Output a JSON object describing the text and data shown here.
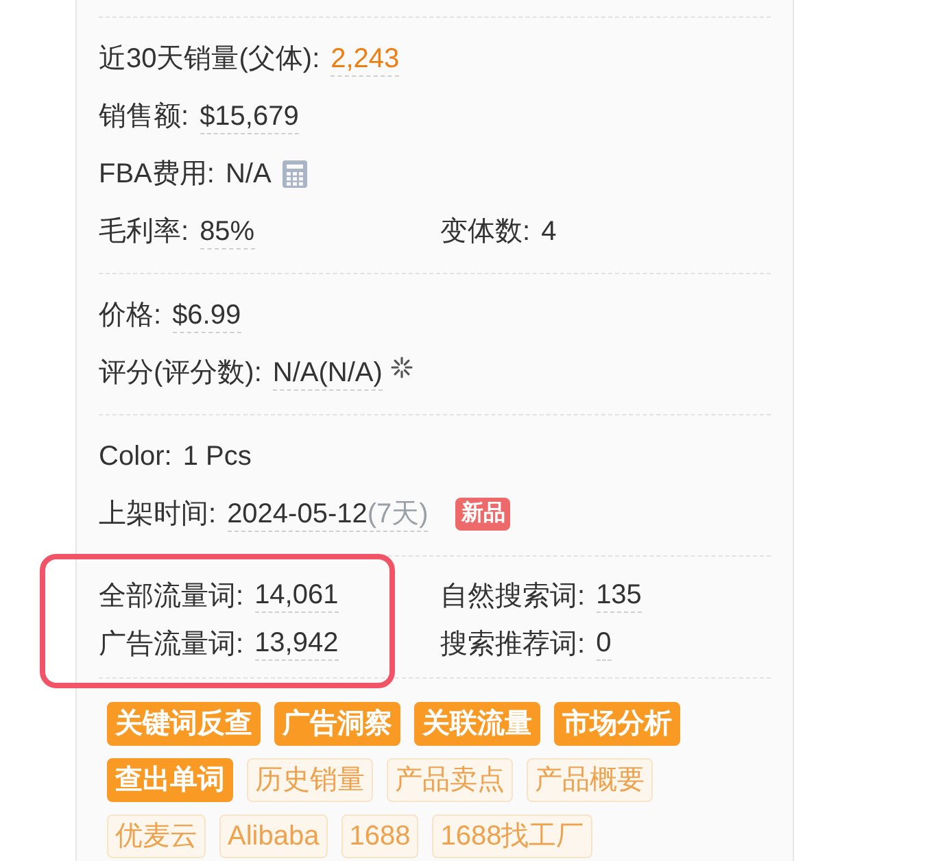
{
  "sections": [
    {
      "boxed": false,
      "rows": [
        [
          {
            "label": "近30天销量(父体):",
            "value": "2,243",
            "underlined": true,
            "accent": true
          }
        ],
        [
          {
            "label": "销售额:",
            "value": "$15,679",
            "underlined": true,
            "accent": false
          }
        ],
        [
          {
            "label": "FBA费用:",
            "value": "N/A",
            "underlined": false,
            "accent": false,
            "kind": "tool"
          }
        ],
        [
          {
            "label": "毛利率:",
            "value": "85%",
            "underlined": true,
            "accent": false
          },
          {
            "label": "变体数:",
            "value": "4",
            "underlined": false,
            "accent": false
          }
        ]
      ]
    },
    {
      "boxed": false,
      "rows": [
        [
          {
            "label": "价格:",
            "value": "$6.99",
            "underlined": true,
            "accent": false
          }
        ],
        [
          {
            "label": "评分(评分数):",
            "value": "N/A(N/A)",
            "underlined": true,
            "accent": false,
            "kind": "pending"
          }
        ]
      ]
    },
    {
      "boxed": false,
      "rows": [
        [
          {
            "label": "Color:",
            "value": "1 Pcs",
            "underlined": false,
            "accent": false
          }
        ],
        [
          {
            "label": "上架时间:",
            "value": "2024-05-12",
            "suffix": "(7天)",
            "underlined": true,
            "accent": false,
            "badge": "新品"
          }
        ]
      ]
    },
    {
      "boxed": true,
      "rows": [
        [
          {
            "label": "全部流量词:",
            "value": "14,061",
            "underlined": true,
            "accent": false
          },
          {
            "label": "自然搜索词:",
            "value": "135",
            "underlined": true,
            "accent": false
          }
        ],
        [
          {
            "label": "广告流量词:",
            "value": "13,942",
            "underlined": true,
            "accent": false
          },
          {
            "label": "搜索推荐词:",
            "value": "0",
            "underlined": true,
            "accent": false
          }
        ]
      ]
    }
  ],
  "buttons": [
    {
      "label": "关键词反查",
      "kind": "primary"
    },
    {
      "label": "广告洞察",
      "kind": "primary"
    },
    {
      "label": "关联流量",
      "kind": "primary"
    },
    {
      "label": "市场分析",
      "kind": "primary"
    },
    {
      "label": "查出单词",
      "kind": "primary"
    },
    {
      "label": "历史销量",
      "kind": "secondary"
    },
    {
      "label": "产品卖点",
      "kind": "secondary"
    },
    {
      "label": "产品概要",
      "kind": "secondary"
    },
    {
      "label": "优麦云",
      "kind": "secondary"
    },
    {
      "label": "Alibaba",
      "kind": "secondary"
    },
    {
      "label": "1688",
      "kind": "secondary"
    },
    {
      "label": "1688找工厂",
      "kind": "secondary"
    }
  ]
}
